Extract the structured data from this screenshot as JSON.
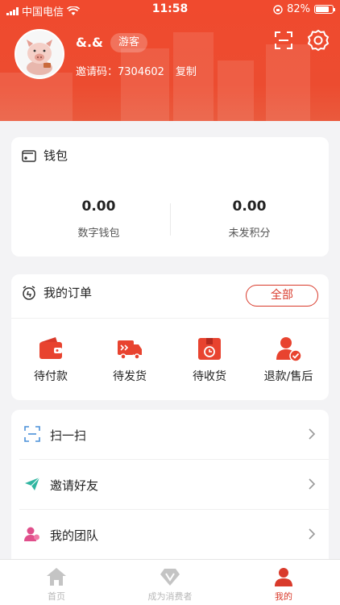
{
  "status_bar": {
    "carrier": "中国电信",
    "time": "11:58",
    "battery": "82%",
    "battery_level": 0.82
  },
  "profile": {
    "username": "&.&",
    "role_badge": "游客",
    "invite_label": "邀请码：7304602",
    "copy_label": "复制"
  },
  "wallet": {
    "title": "钱包",
    "items": [
      {
        "value": "0.00",
        "label": "数字钱包"
      },
      {
        "value": "0.00",
        "label": "未发积分"
      }
    ]
  },
  "orders": {
    "title": "我的订单",
    "all_label": "全部",
    "items": [
      {
        "label": "待付款",
        "icon": "wallet-icon"
      },
      {
        "label": "待发货",
        "icon": "truck-icon"
      },
      {
        "label": "待收货",
        "icon": "package-icon"
      },
      {
        "label": "退款/售后",
        "icon": "refund-user-icon"
      }
    ]
  },
  "menu": {
    "items": [
      {
        "label": "扫一扫",
        "icon": "scan-icon"
      },
      {
        "label": "邀请好友",
        "icon": "paper-plane-icon"
      },
      {
        "label": "我的团队",
        "icon": "team-icon"
      }
    ]
  },
  "tabbar": {
    "tabs": [
      {
        "label": "首页",
        "icon": "home-icon"
      },
      {
        "label": "成为消费者",
        "icon": "diamond-v-icon"
      },
      {
        "label": "我的",
        "icon": "profile-icon",
        "active": true
      }
    ]
  },
  "colors": {
    "brand": "#ec4a2e",
    "accent": "#d93a2b",
    "tab_inactive": "#b8b8b8"
  }
}
